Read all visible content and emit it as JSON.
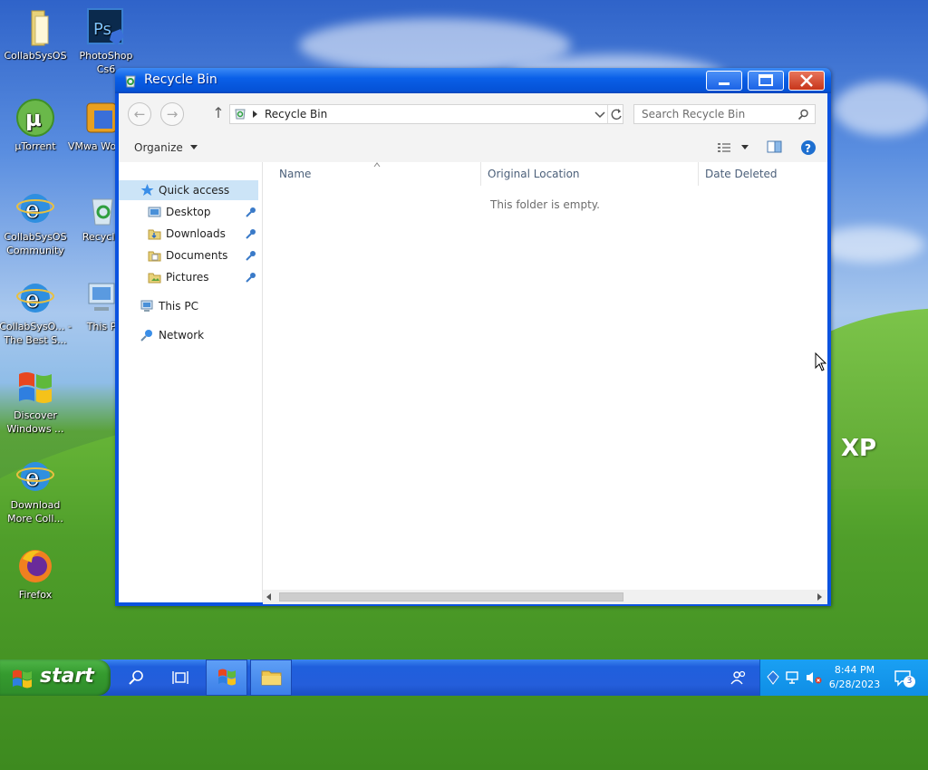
{
  "desktop": {
    "icons": [
      {
        "label": "CollabSysOS",
        "name": "collabsysos-folder"
      },
      {
        "label": "PhotoShop Cs6",
        "name": "photoshop"
      },
      {
        "label": "µTorrent",
        "name": "utorrent"
      },
      {
        "label": "VMwa Workst",
        "name": "vmware"
      },
      {
        "label": "CollabSysOS Community",
        "name": "collabsysos-community"
      },
      {
        "label": "Recycle",
        "name": "recycle-bin"
      },
      {
        "label": "CollabSysO... - The Best S...",
        "name": "collabsysos-best"
      },
      {
        "label": "This P",
        "name": "this-pc"
      },
      {
        "label": "Discover Windows ...",
        "name": "discover-windows"
      },
      {
        "label": "Download More Coll...",
        "name": "download-more"
      },
      {
        "label": "Firefox",
        "name": "firefox"
      }
    ],
    "watermark": "XP"
  },
  "window": {
    "title": "Recycle Bin",
    "address": "Recycle Bin",
    "search_placeholder": "Search Recycle Bin",
    "organize_label": "Organize",
    "nav": {
      "quick_access": "Quick access",
      "desktop": "Desktop",
      "downloads": "Downloads",
      "documents": "Documents",
      "pictures": "Pictures",
      "this_pc": "This PC",
      "network": "Network"
    },
    "columns": {
      "name": "Name",
      "original_location": "Original Location",
      "date_deleted": "Date Deleted"
    },
    "empty_message": "This folder is empty."
  },
  "taskbar": {
    "start_label": "start",
    "time": "8:44 PM",
    "date": "6/28/2023",
    "notification_count": "3"
  },
  "colors": {
    "title_blue": "#0a5fe8",
    "start_green": "#359b2f",
    "selection": "#cce4f7"
  }
}
